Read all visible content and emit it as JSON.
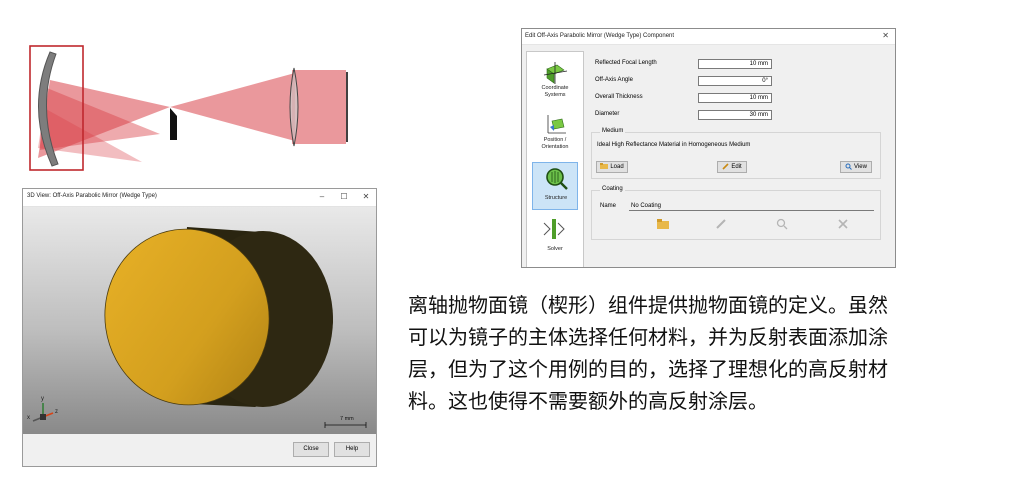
{
  "view3d": {
    "title": "3D View: Off-Axis Parabolic Mirror (Wedge Type)",
    "window_controls": [
      "–",
      "☐",
      "✕"
    ],
    "scale_label": "7 mm",
    "axes": {
      "x": "x",
      "y": "y",
      "z": "z"
    },
    "buttons": {
      "close": "Close",
      "help": "Help"
    },
    "colors": {
      "mirror_face": "#d4a21c",
      "mirror_body": "#2a2510"
    }
  },
  "dialog": {
    "title": "Edit Off-Axis Parabolic Mirror (Wedge Type) Component",
    "close": "✕",
    "nav": [
      {
        "label": "Coordinate Systems",
        "icon": "coordinate-systems-icon"
      },
      {
        "label": "Position / Orientation",
        "icon": "position-orientation-icon"
      },
      {
        "label": "Structure",
        "icon": "structure-icon"
      },
      {
        "label": "Solver",
        "icon": "solver-icon"
      }
    ],
    "fields": [
      {
        "label": "Reflected Focal Length",
        "value": "10 mm"
      },
      {
        "label": "Off-Axis Angle",
        "value": "0°"
      },
      {
        "label": "Overall Thickness",
        "value": "10 mm"
      },
      {
        "label": "Diameter",
        "value": "30 mm"
      }
    ],
    "medium": {
      "title": "Medium",
      "value": "Ideal High Reflectance Material in Homogeneous Medium",
      "load": "Load",
      "edit": "Edit",
      "view": "View"
    },
    "coating": {
      "title": "Coating",
      "name_label": "Name",
      "name_value": "No Coating"
    }
  },
  "caption": {
    "lines": [
      "离轴抛物面镜（楔形）组件提供抛物面镜的定义。虽然",
      "可以为镜子的主体选择任何材料，并为反射表面添加涂",
      "层，但为了这个用例的目的，选择了理想化的高反射材",
      "料。这也使得不需要额外的高反射涂层。"
    ]
  }
}
